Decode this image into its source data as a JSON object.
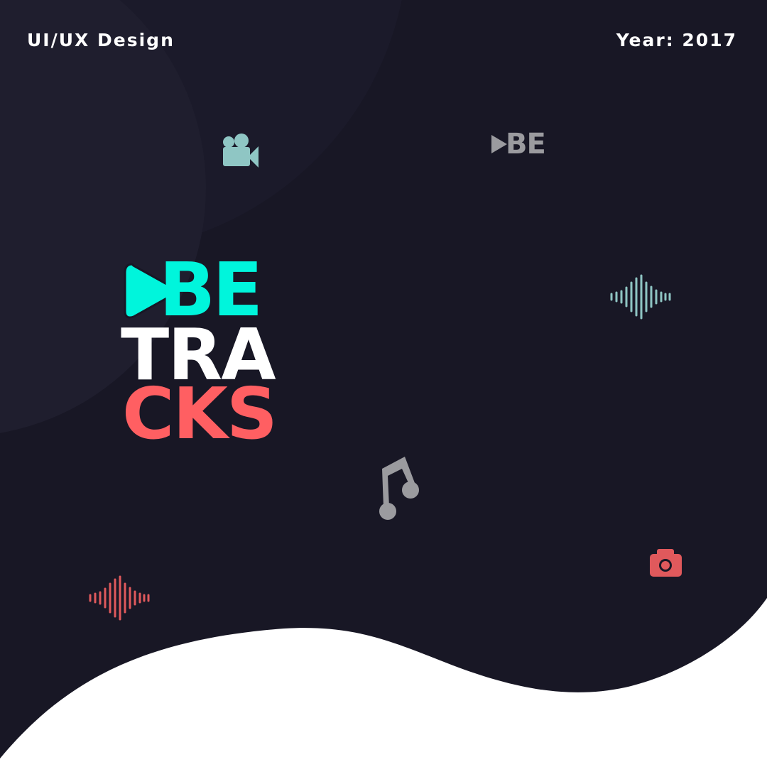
{
  "header": {
    "category": "UI/UX Design",
    "year": "Year: 2017"
  },
  "logo": {
    "line1": "BE",
    "line2": "TRA",
    "line3": "CKS",
    "play_icon": "play-icon",
    "colors": {
      "line1": "#00f5dc",
      "line2": "#ffffff",
      "line3": "#ff5f62"
    }
  },
  "decorations": {
    "mini_logo_text": "BE",
    "icons": [
      "video-camera-icon",
      "play-icon",
      "sound-wave-icon",
      "music-note-icon",
      "camera-icon",
      "sound-wave-icon"
    ]
  },
  "colors": {
    "background": "#181725",
    "panel": "#1d1c2b",
    "white_area": "#ffffff",
    "accent_teal": "#00f5dc",
    "accent_coral": "#ff5f62",
    "muted_teal": "#8fc6c4",
    "muted_gray": "#9b9b9f",
    "muted_coral": "#e0595c"
  }
}
